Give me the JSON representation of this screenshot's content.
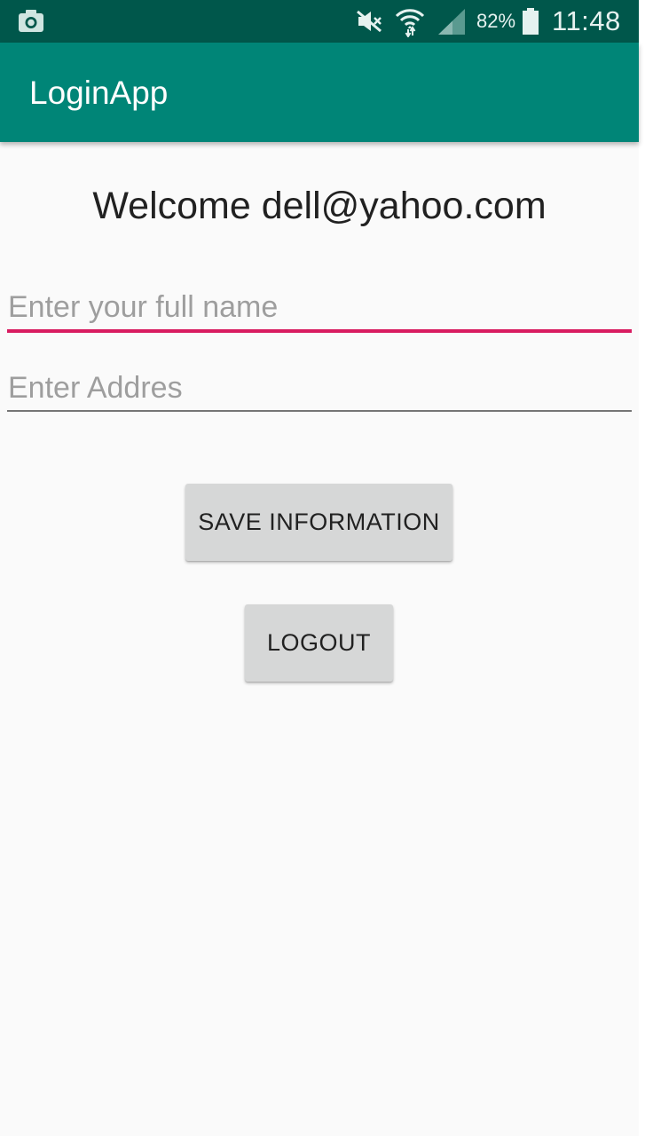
{
  "status_bar": {
    "icons": [
      "camera-icon",
      "mute-icon",
      "wifi-icon",
      "signal-icon",
      "battery-icon"
    ],
    "battery_percent": "82%",
    "time": "11:48"
  },
  "app_bar": {
    "title": "LoginApp"
  },
  "main": {
    "welcome_text": "Welcome dell@yahoo.com",
    "full_name_field": {
      "value": "",
      "placeholder": "Enter your full name"
    },
    "address_field": {
      "value": "",
      "placeholder": "Enter Addres"
    },
    "save_button_label": "SAVE INFORMATION",
    "logout_button_label": "LOGOUT"
  },
  "colors": {
    "status_bar": "#00574b",
    "app_bar": "#008577",
    "accent": "#d81b60",
    "background": "#fafafa",
    "button": "#d6d7d7"
  }
}
